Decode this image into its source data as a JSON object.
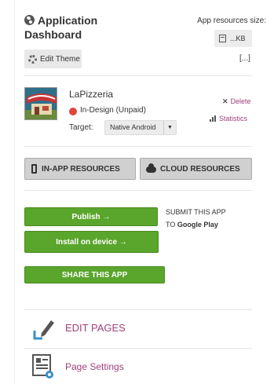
{
  "header": {
    "title": "Application Dashboard",
    "edit_theme_label": "Edit Theme",
    "resources_size_label": "App resources size:",
    "resources_size_value": "...KB",
    "more_label": "[...]"
  },
  "app": {
    "name": "LaPizzeria",
    "status": "In-Design (Unpaid)",
    "status_color": "#e0453d",
    "delete_label": "Delete",
    "statistics_label": "Statistics",
    "target_label": "Target:",
    "target_value": "Native Android"
  },
  "resources": {
    "inapp_label": "IN-APP RESOURCES",
    "cloud_label": "CLOUD RESOURCES"
  },
  "actions": {
    "publish_label": "Publish →",
    "install_label": "Install on device →",
    "share_label": "SHARE THIS APP",
    "submit_line1": "SUBMIT THIS APP",
    "submit_line2_prefix": "TO",
    "submit_line2_store": "Google Play"
  },
  "links": {
    "edit_pages_label": "EDIT PAGES",
    "page_settings_label": "Page Settings"
  },
  "colors": {
    "accent": "#a0417b",
    "green": "#5aa52c"
  }
}
